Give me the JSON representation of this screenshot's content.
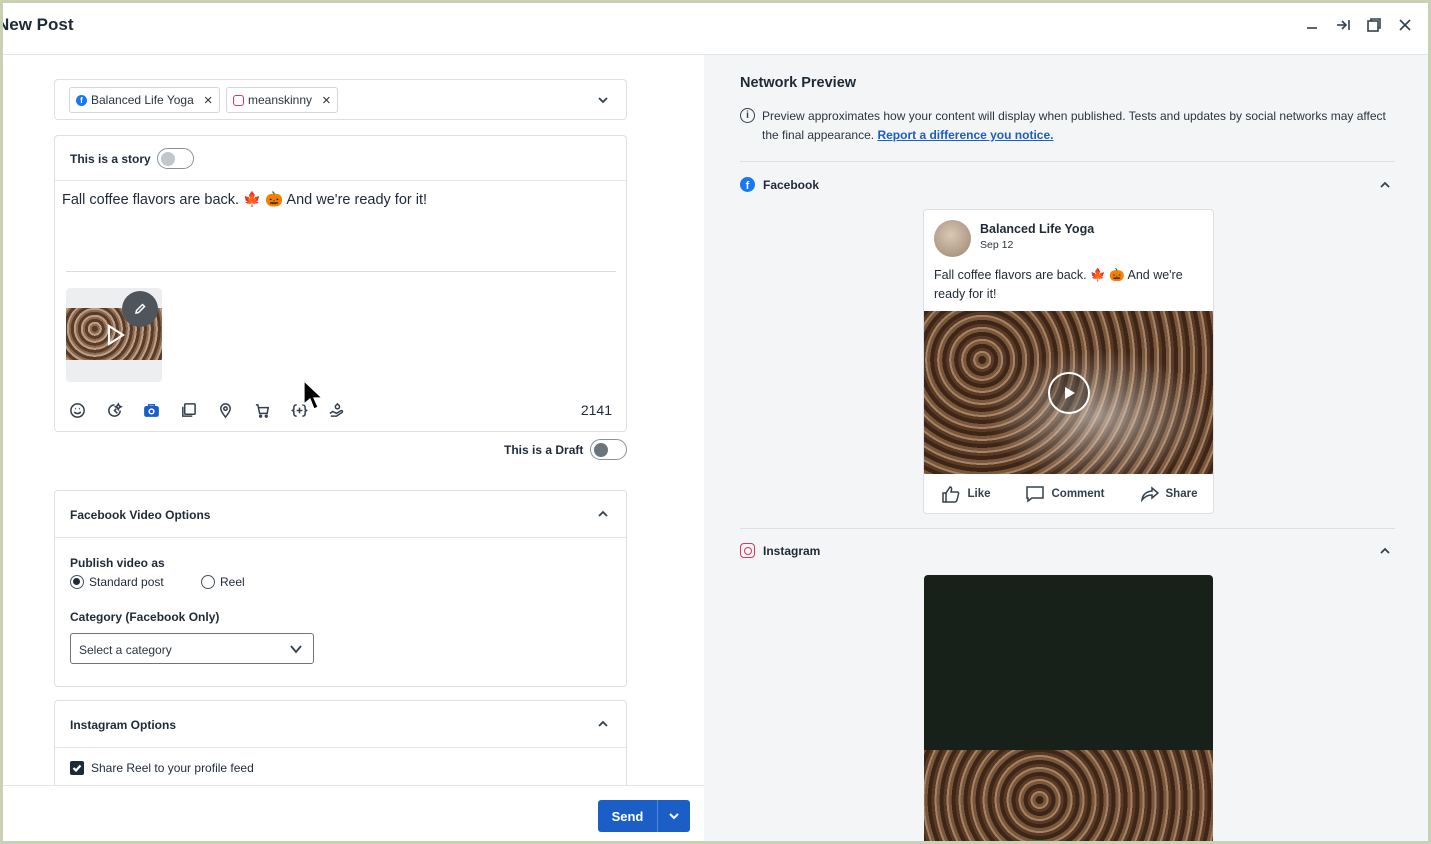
{
  "window": {
    "title": "New Post",
    "controls": [
      "minimize-icon",
      "collapse-to-side-icon",
      "restore-icon",
      "close-icon"
    ]
  },
  "profiles": {
    "chips": [
      {
        "network": "facebook",
        "label": "Balanced Life Yoga"
      },
      {
        "network": "instagram",
        "label": "meanskinny"
      }
    ]
  },
  "composer": {
    "story_label": "This is a story",
    "text": "Fall coffee flavors are back. 🍁 🎃 And we're ready for it!",
    "char_count": "2141",
    "toolbar_icons": [
      "emoji-icon",
      "ai-assist-icon",
      "camera-icon",
      "media-library-icon",
      "location-icon",
      "shopping-icon",
      "variables-icon",
      "hand-icon"
    ]
  },
  "draft": {
    "label": "This is a Draft"
  },
  "facebook_video_options": {
    "title": "Facebook Video Options",
    "publish_label": "Publish video as",
    "options": [
      "Standard post",
      "Reel"
    ],
    "selected": "Standard post",
    "category_label": "Category (Facebook Only)",
    "category_placeholder": "Select a category"
  },
  "instagram_options": {
    "title": "Instagram Options",
    "share_reel_label": "Share Reel to your profile feed",
    "share_reel_checked": true
  },
  "footer": {
    "send_label": "Send"
  },
  "preview": {
    "title": "Network Preview",
    "info_text": "Preview approximates how your content will display when published. Tests and updates by social networks may affect the final appearance.",
    "info_link": "Report a difference you notice.",
    "facebook": {
      "section_label": "Facebook",
      "page_name": "Balanced Life Yoga",
      "date": "Sep 12",
      "post_text": "Fall coffee flavors are back. 🍁 🎃 And we're ready for it!",
      "actions": [
        "Like",
        "Comment",
        "Share"
      ]
    },
    "instagram": {
      "section_label": "Instagram"
    }
  },
  "colors": {
    "brand_blue": "#1b5ec6",
    "facebook_blue": "#1877f2",
    "instagram_pink": "#d7385e"
  }
}
